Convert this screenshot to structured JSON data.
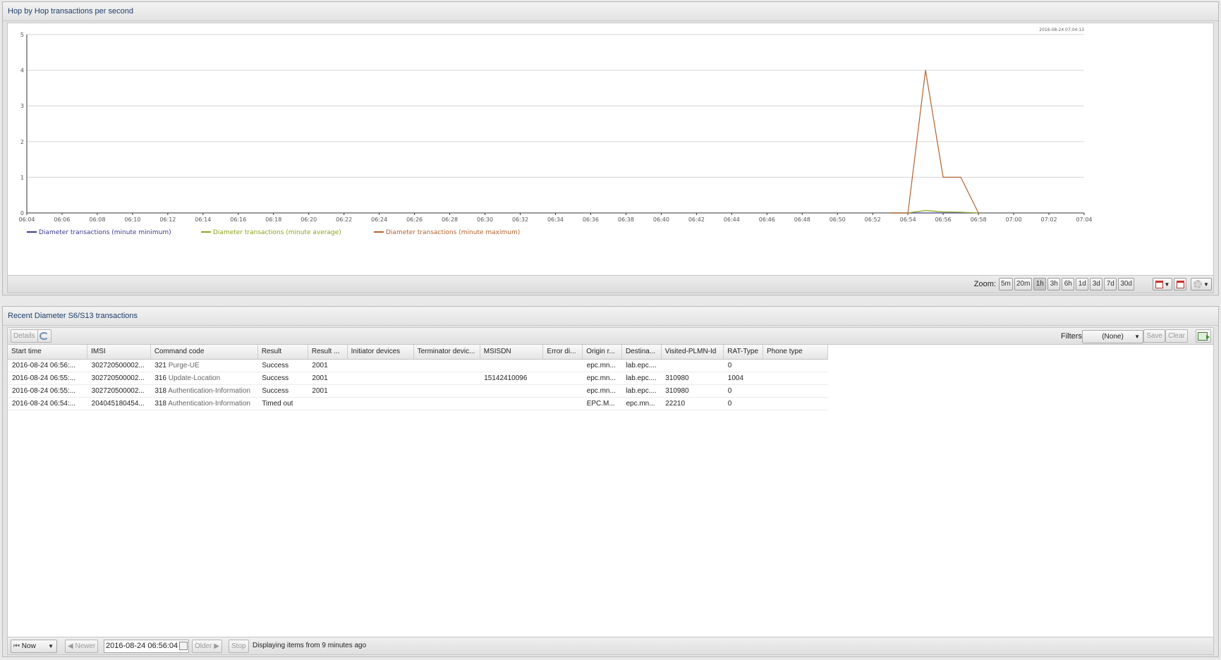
{
  "chart_panel": {
    "title": "Hop by Hop transactions per second",
    "zoom_label": "Zoom:",
    "zoom_options": [
      "5m",
      "20m",
      "1h",
      "3h",
      "6h",
      "1d",
      "3d",
      "7d",
      "30d"
    ],
    "zoom_active": "1h"
  },
  "chart_data": {
    "type": "line",
    "timestamp": "2016-08-24 07:04:13",
    "x": [
      "06:04",
      "06:06",
      "06:08",
      "06:10",
      "06:12",
      "06:14",
      "06:16",
      "06:18",
      "06:20",
      "06:22",
      "06:24",
      "06:26",
      "06:28",
      "06:30",
      "06:32",
      "06:34",
      "06:36",
      "06:38",
      "06:40",
      "06:42",
      "06:44",
      "06:46",
      "06:48",
      "06:50",
      "06:52",
      "06:54",
      "06:56",
      "06:58",
      "07:00",
      "07:02",
      "07:04"
    ],
    "ylim": [
      0,
      5
    ],
    "yticks": [
      "0",
      "1",
      "2",
      "3",
      "4",
      "5"
    ],
    "grid": true,
    "legend_position": "bottom-left",
    "series": [
      {
        "name": "Diameter transactions (minute minimum)",
        "color": "#3b3b8f",
        "points": [
          [
            "06:53",
            0
          ],
          [
            "06:54",
            0
          ],
          [
            "06:55",
            0
          ],
          [
            "06:56",
            0
          ],
          [
            "06:57",
            0
          ],
          [
            "06:58",
            0
          ]
        ]
      },
      {
        "name": "Diameter transactions (minute average)",
        "color": "#8aa61e",
        "points": [
          [
            "06:53",
            0
          ],
          [
            "06:54",
            0
          ],
          [
            "06:55",
            0.07
          ],
          [
            "06:56",
            0.03
          ],
          [
            "06:57",
            0.02
          ],
          [
            "06:58",
            0
          ]
        ]
      },
      {
        "name": "Diameter transactions (minute maximum)",
        "color": "#b3622f",
        "points": [
          [
            "06:53",
            0
          ],
          [
            "06:54",
            0
          ],
          [
            "06:55",
            4
          ],
          [
            "06:56",
            1
          ],
          [
            "06:57",
            1
          ],
          [
            "06:58",
            0
          ]
        ]
      }
    ]
  },
  "table_panel": {
    "title": "Recent Diameter S6/S13 transactions",
    "details_label": "Details",
    "filters_label": "Filters:",
    "filters_value": "(None)",
    "save_label": "Save",
    "clear_label": "Clear",
    "columns": [
      "Start time",
      "IMSI",
      "Command code",
      "Result",
      "Result ...",
      "Initiator devices",
      "Terminator devic...",
      "MSISDN",
      "Error di...",
      "Origin r...",
      "Destina...",
      "Visited-PLMN-Id",
      "RAT-Type",
      "Phone type"
    ],
    "rows": [
      {
        "start": "2016-08-24 06:56:...",
        "imsi": "302720500002...",
        "code_num": "321",
        "code_name": "Purge-UE",
        "result": "Success",
        "result_code": "2001",
        "initiator": "",
        "terminator": "",
        "msisdn": "",
        "error": "",
        "origin": "epc.mn...",
        "dest": "lab.epc....",
        "plmn": "",
        "rat": "0",
        "phone": ""
      },
      {
        "start": "2016-08-24 06:55:...",
        "imsi": "302720500002...",
        "code_num": "316",
        "code_name": "Update-Location",
        "result": "Success",
        "result_code": "2001",
        "initiator": "",
        "terminator": "",
        "msisdn": "15142410096",
        "error": "",
        "origin": "epc.mn...",
        "dest": "lab.epc....",
        "plmn": "310980",
        "rat": "1004",
        "phone": ""
      },
      {
        "start": "2016-08-24 06:55:...",
        "imsi": "302720500002...",
        "code_num": "318",
        "code_name": "Authentication-Information",
        "result": "Success",
        "result_code": "2001",
        "initiator": "",
        "terminator": "",
        "msisdn": "",
        "error": "",
        "origin": "epc.mn...",
        "dest": "lab.epc....",
        "plmn": "310980",
        "rat": "0",
        "phone": ""
      },
      {
        "start": "2016-08-24 06:54:...",
        "imsi": "204045180454...",
        "code_num": "318",
        "code_name": "Authentication-Information",
        "result": "Timed out",
        "result_code": "",
        "initiator": "",
        "terminator": "",
        "msisdn": "",
        "error": "",
        "origin": "EPC.M...",
        "dest": "epc.mn...",
        "plmn": "22210",
        "rat": "0",
        "phone": ""
      }
    ]
  },
  "status_bar": {
    "now_label": "Now",
    "newer_label": "Newer",
    "date_value": "2016-08-24 06:56:04",
    "older_label": "Older",
    "stop_label": "Stop",
    "status_text": "Displaying items from 9 minutes ago"
  }
}
